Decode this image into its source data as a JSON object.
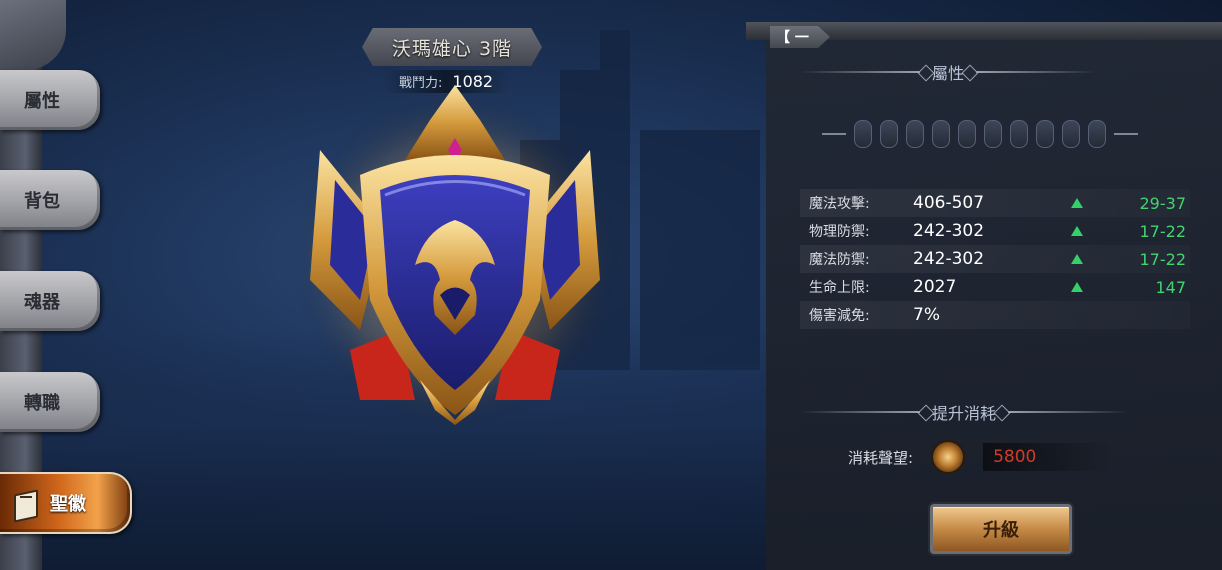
{
  "emblem": {
    "title": "沃瑪雄心 3階",
    "power_label": "戰鬥力:",
    "power_value": "1082"
  },
  "nav": {
    "tabs": [
      {
        "label": "屬性",
        "active": false
      },
      {
        "label": "背包",
        "active": false
      },
      {
        "label": "魂器",
        "active": false
      },
      {
        "label": "轉職",
        "active": false
      },
      {
        "label": "聖徽",
        "active": true,
        "icon": "book-icon"
      }
    ]
  },
  "panel": {
    "close_label": "【 一",
    "attributes_title": "屬性",
    "slot_count": 10,
    "stats": [
      {
        "label": "魔法攻擊:",
        "value": "406-507",
        "bonus": "29-37",
        "up": true
      },
      {
        "label": "物理防禦:",
        "value": "242-302",
        "bonus": "17-22",
        "up": true
      },
      {
        "label": "魔法防禦:",
        "value": "242-302",
        "bonus": "17-22",
        "up": true
      },
      {
        "label": "生命上限:",
        "value": "2027",
        "bonus": "147",
        "up": true
      },
      {
        "label": "傷害減免:",
        "value": "7%",
        "bonus": "",
        "up": false
      }
    ],
    "cost_title": "提升消耗",
    "cost_label": "消耗聲望:",
    "cost_value": "5800",
    "upgrade_label": "升級"
  },
  "colors": {
    "bonus_green": "#43d36f",
    "cost_red": "#d13a2a",
    "active_tab_orange": "#d0661b"
  }
}
